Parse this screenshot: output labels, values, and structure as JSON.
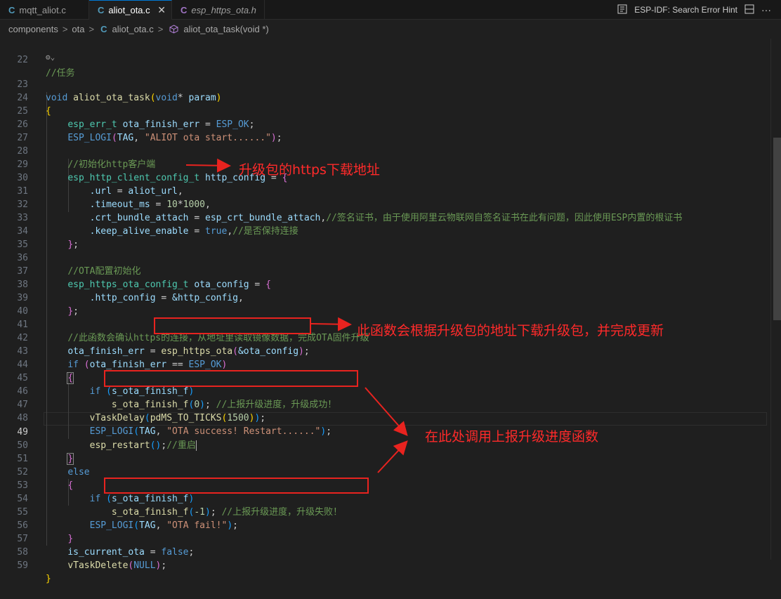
{
  "tabs": [
    {
      "icon": "C",
      "label": "mqtt_aliot.c"
    },
    {
      "icon": "C",
      "label": "aliot_ota.c",
      "close": "✕"
    },
    {
      "icon": "C",
      "label": "esp_https_ota.h"
    }
  ],
  "hint": {
    "label": "ESP-IDF: Search Error Hint"
  },
  "breadcrumb": {
    "seg1": "components",
    "seg2": "ota",
    "seg3_icon": "C",
    "seg3": "aliot_ota.c",
    "seg4": "aliot_ota_task(void *)"
  },
  "editor": {
    "line_numbers": [
      "22",
      "23",
      "24",
      "25",
      "26",
      "27",
      "28",
      "29",
      "30",
      "31",
      "32",
      "33",
      "34",
      "35",
      "36",
      "37",
      "38",
      "39",
      "40",
      "41",
      "42",
      "43",
      "44",
      "45",
      "46",
      "47",
      "48",
      "49",
      "50",
      "51",
      "52",
      "53",
      "54",
      "55",
      "56",
      "57",
      "58",
      "59"
    ],
    "codelens": "⚙⌄",
    "tokens": {
      "void": "void",
      "aliot_ota_task": "aliot_ota_task",
      "param": "param",
      "star": "*",
      "esp_err_t": "esp_err_t",
      "ota_finish_err": "ota_finish_err",
      "esp_ok": "ESP_OK",
      "esp_logi": "ESP_LOGI",
      "tag": "TAG",
      "str_start": "\"ALIOT ota start......\"",
      "esp_http_client_config_t": "esp_http_client_config_t",
      "http_config": "http_config",
      "url": ".url",
      "aliot_url": "aliot_url",
      "timeout_ms": ".timeout_ms",
      "n10": "10",
      "n1000": "1000",
      "crt_bundle_attach": ".crt_bundle_attach",
      "esp_crt_bundle_attach": "esp_crt_bundle_attach",
      "keep_alive_enable": ".keep_alive_enable",
      "true": "true",
      "esp_https_ota_config_t": "esp_https_ota_config_t",
      "ota_config": "ota_config",
      "http_config_field": ".http_config",
      "amp_http_config": "&http_config",
      "esp_https_ota": "esp_https_ota",
      "amp_ota_config": "&ota_config",
      "if": "if",
      "else": "else",
      "s_ota_finish_f": "s_ota_finish_f",
      "n0": "0",
      "neg1": "-1",
      "vTaskDelay": "vTaskDelay",
      "pdMS_TO_TICKS": "pdMS_TO_TICKS",
      "n1500": "1500",
      "str_success": "\"OTA success! Restart......\"",
      "esp_restart": "esp_restart",
      "str_fail": "\"OTA fail!\"",
      "is_current_ota": "is_current_ota",
      "false": "false",
      "vTaskDelete": "vTaskDelete",
      "null": "NULL"
    },
    "comments": {
      "c22": "//任务",
      "c28": "//初始化http客户端",
      "c32": "//签名证书，由于使用阿里云物联网自签名证书在此有问题，因此使用ESP内置的根证书",
      "c33": "//是否保持连接",
      "c36": "//OTA配置初始化",
      "c41": "//此函数会确认https的连接，从地址里读取镜像数据，完成OTA固件升级",
      "c46": "//上报升级进度，升级成功！",
      "c49": "//重启",
      "c54": "//上报升级进度，升级失败！"
    }
  },
  "annotations": {
    "note1": "升级包的https下载地址",
    "note2": "此函数会根据升级包的地址下载升级包，并完成更新",
    "note3": "在此处调用上报升级进度函数",
    "color": "#ff2a2a"
  },
  "colors": {
    "accent": "#0078d4",
    "keyword": "#569cd6",
    "function": "#dcdcaa",
    "type": "#4ec9b0",
    "variable": "#9cdcfe",
    "string": "#ce9178",
    "number": "#b5cea8",
    "comment": "#6a9955"
  }
}
